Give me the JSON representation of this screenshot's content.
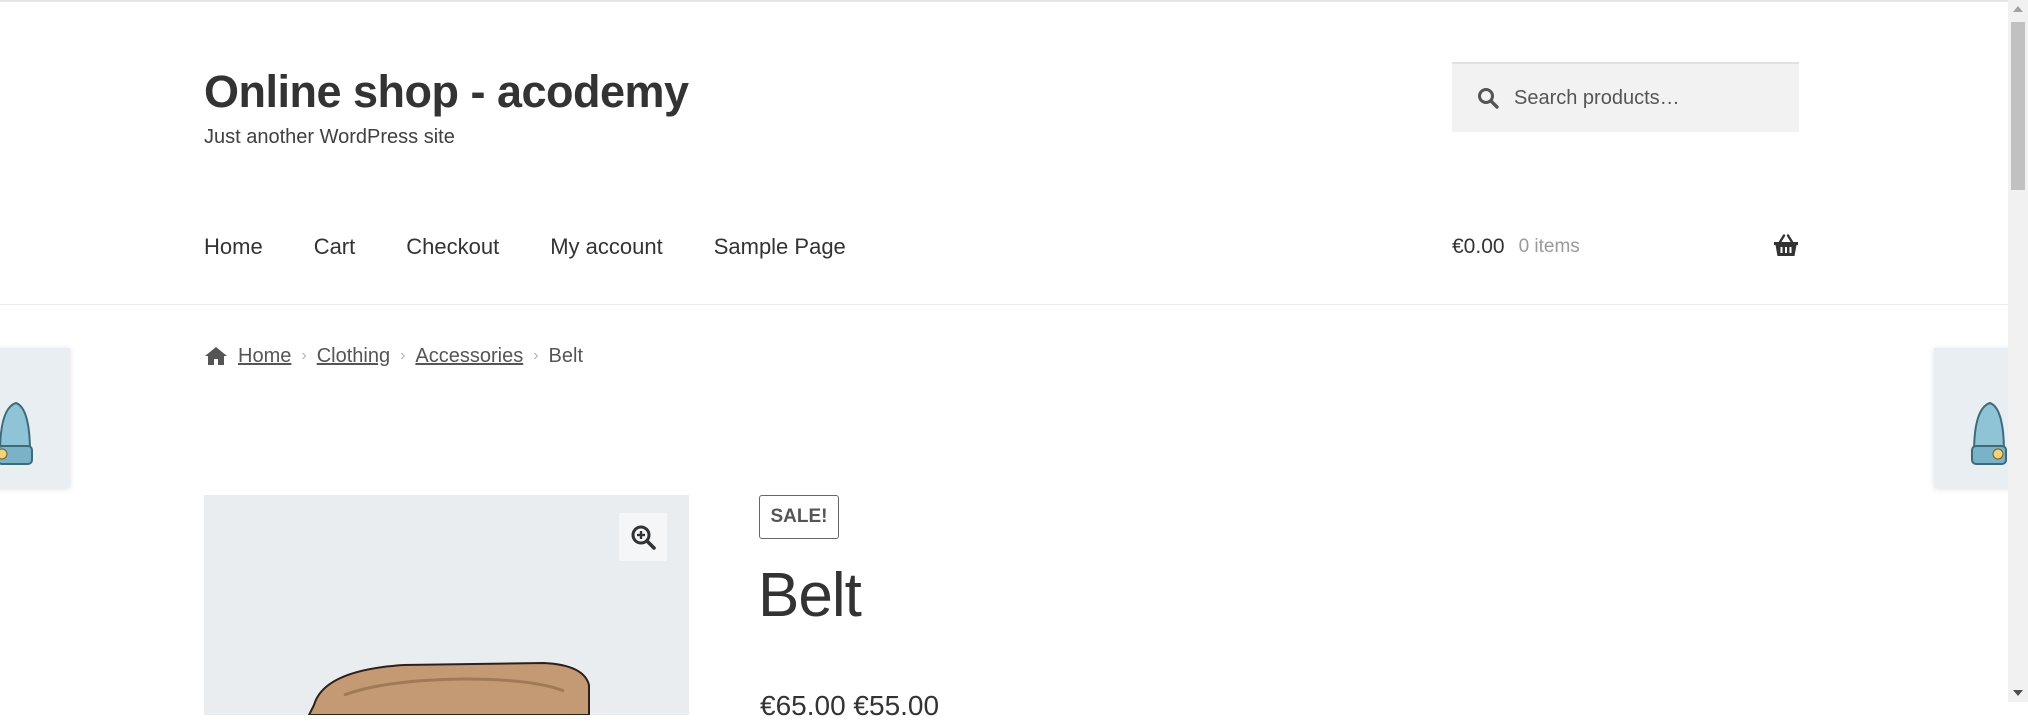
{
  "site": {
    "title": "Online shop - acodemy",
    "tagline": "Just another WordPress site"
  },
  "search": {
    "placeholder": "Search products…",
    "value": ""
  },
  "nav": {
    "items": [
      "Home",
      "Cart",
      "Checkout",
      "My account",
      "Sample Page"
    ]
  },
  "cart": {
    "amount": "€0.00",
    "count": "0 items"
  },
  "breadcrumb": {
    "home": "Home",
    "clothing": "Clothing",
    "accessories": "Accessories",
    "current": "Belt"
  },
  "product": {
    "badge": "SALE!",
    "title": "Belt",
    "price": "€65.00 €55.00"
  },
  "icons": {
    "search": "search-icon",
    "basket": "basket-icon",
    "home": "home-icon",
    "zoom": "zoom-icon",
    "chevron": "chevron-right-icon"
  },
  "colors": {
    "text": "#333333",
    "muted": "#9a9a9a",
    "search_bg": "#f2f2f2",
    "gallery_bg": "#e9edf0"
  }
}
